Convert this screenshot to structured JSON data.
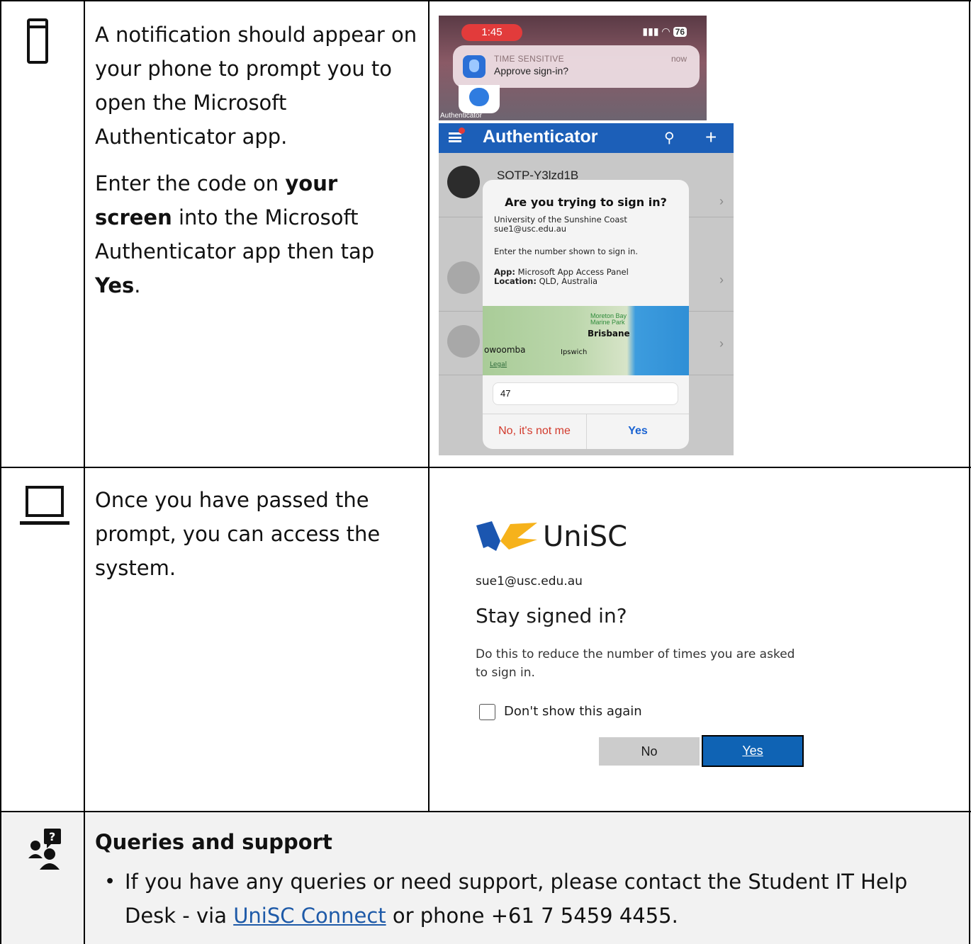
{
  "rows": {
    "phone": {
      "para1": "A notification should appear on your phone to prompt you to open the Microsoft Authenticator app.",
      "para2_a": "Enter the code on ",
      "para2_b": "your screen",
      "para2_c": " into the Microsoft Authenticator app then tap ",
      "para2_d": "Yes",
      "para2_e": "."
    },
    "laptop": {
      "para": "Once you have passed the prompt, you can access the system."
    }
  },
  "phone_screenshot": {
    "time": "1:45",
    "battery": "76",
    "notification": {
      "label": "TIME SENSITIVE",
      "message": "Approve sign-in?",
      "time": "now"
    },
    "app_label": "Authenticator",
    "app_title": "Authenticator",
    "account_name": "SOTP-Y3lzd1B",
    "dialog": {
      "title": "Are you trying to sign in?",
      "org": "University of the Sunshine Coast",
      "email": "sue1@usc.edu.au",
      "instruction": "Enter the number shown to sign in.",
      "app_label": "App:",
      "app_value": " Microsoft App Access Panel",
      "location_label": "Location:",
      "location_value": " QLD, Australia",
      "map": {
        "park": "Moreton Bay Marine Park",
        "city": "Brisbane",
        "town1": "owoomba",
        "town2": "Ipswich",
        "legal": "Legal"
      },
      "code_value": "47",
      "no_button": "No, it's not me",
      "yes_button": "Yes"
    }
  },
  "stay_signed_in": {
    "brand": "UniSC",
    "email": "sue1@usc.edu.au",
    "title": "Stay signed in?",
    "description": "Do this to reduce the number of times you are asked to sign in.",
    "checkbox_label": "Don't show this again",
    "no_button": "No",
    "yes_button": "Yes"
  },
  "support": {
    "title": "Queries and support",
    "text_before": "If you have any queries or need support, please contact the Student IT Help Desk - via ",
    "link": "UniSC Connect",
    "text_after": " or phone +61 7 5459 4455."
  },
  "icons": [
    "phone-icon",
    "laptop-icon",
    "support-icon"
  ]
}
